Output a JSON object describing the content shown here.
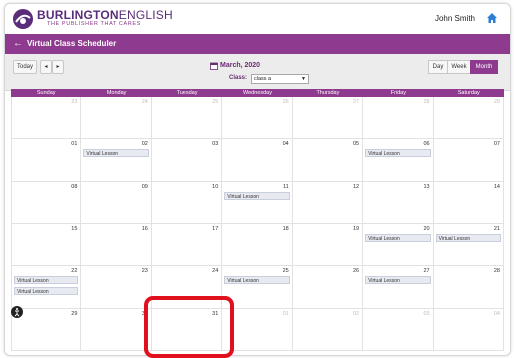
{
  "header": {
    "brand_bold": "BURLINGTON",
    "brand_light": "ENGLISH",
    "tagline": "THE PUBLISHER THAT CARES",
    "user_name": "John Smith"
  },
  "titlebar": {
    "title": "Virtual Class Scheduler"
  },
  "toolbar": {
    "today_label": "Today",
    "prev_label": "◂",
    "next_label": "▸",
    "month_title": "March, 2020",
    "class_label": "Class:",
    "class_value": "class a",
    "views": [
      "Day",
      "Week",
      "Month"
    ],
    "active_view": "Month"
  },
  "calendar": {
    "days": [
      "Sunday",
      "Monday",
      "Tuesday",
      "Wednesday",
      "Thursday",
      "Friday",
      "Saturday"
    ],
    "weeks": [
      [
        {
          "d": "23",
          "o": true
        },
        {
          "d": "24",
          "o": true
        },
        {
          "d": "25",
          "o": true
        },
        {
          "d": "26",
          "o": true
        },
        {
          "d": "27",
          "o": true
        },
        {
          "d": "28",
          "o": true
        },
        {
          "d": "29",
          "o": true
        }
      ],
      [
        {
          "d": "01"
        },
        {
          "d": "02",
          "e": [
            "Virtual Lesson"
          ]
        },
        {
          "d": "03"
        },
        {
          "d": "04"
        },
        {
          "d": "05"
        },
        {
          "d": "06",
          "e": [
            "Virtual Lesson"
          ]
        },
        {
          "d": "07"
        }
      ],
      [
        {
          "d": "08"
        },
        {
          "d": "09"
        },
        {
          "d": "10"
        },
        {
          "d": "11",
          "e": [
            "Virtual Lesson"
          ]
        },
        {
          "d": "12"
        },
        {
          "d": "13"
        },
        {
          "d": "14"
        }
      ],
      [
        {
          "d": "15"
        },
        {
          "d": "16"
        },
        {
          "d": "17"
        },
        {
          "d": "18"
        },
        {
          "d": "19"
        },
        {
          "d": "20",
          "e": [
            "Virtual Lesson"
          ]
        },
        {
          "d": "21",
          "e": [
            "Virtual Lesson"
          ]
        }
      ],
      [
        {
          "d": "22",
          "e": [
            "Virtual Lesson",
            "Virtual Lesson"
          ]
        },
        {
          "d": "23"
        },
        {
          "d": "24"
        },
        {
          "d": "25",
          "e": [
            "Virtual Lesson"
          ]
        },
        {
          "d": "26"
        },
        {
          "d": "27",
          "e": [
            "Virtual Lesson"
          ]
        },
        {
          "d": "28"
        }
      ],
      [
        {
          "d": "29"
        },
        {
          "d": "30"
        },
        {
          "d": "31"
        },
        {
          "d": "01",
          "o": true
        },
        {
          "d": "02",
          "o": true
        },
        {
          "d": "03",
          "o": true
        },
        {
          "d": "04",
          "o": true
        }
      ]
    ]
  },
  "colors": {
    "brand": "#8e3a8f",
    "highlight": "#e0101c",
    "home_icon": "#2a7fd4"
  },
  "icons": {
    "back": "arrow-left-icon",
    "home": "home-icon",
    "calendar": "calendar-icon",
    "accessibility": "accessibility-icon"
  }
}
